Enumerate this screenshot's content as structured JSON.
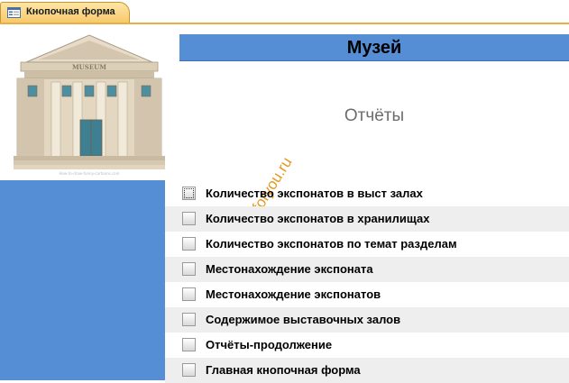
{
  "tab": {
    "label": "Кнопочная форма",
    "icon": "form-icon"
  },
  "header": {
    "title": "Музей",
    "band_color": "#558ed5"
  },
  "subtitle": "Отчёты",
  "image": {
    "icon": "museum-building-illustration",
    "sign_text": "MUSEUM"
  },
  "watermark": "dbforyou.ru",
  "menu": {
    "items": [
      {
        "label": "Количество экспонатов в выст залах"
      },
      {
        "label": "Количество экспонатов в хранилищах"
      },
      {
        "label": "Количество экспонатов по темат разделам"
      },
      {
        "label": "Местонахождение экспоната"
      },
      {
        "label": "Местонахождение экспонатов"
      },
      {
        "label": "Содержимое выставочных залов"
      },
      {
        "label": "Отчёты-продолжение"
      },
      {
        "label": "Главная кнопочная форма"
      }
    ]
  },
  "colors": {
    "accent": "#558ed5",
    "row_alt": "#eeeeee",
    "tab": "#f7c86a",
    "watermark": "#e59a20"
  }
}
